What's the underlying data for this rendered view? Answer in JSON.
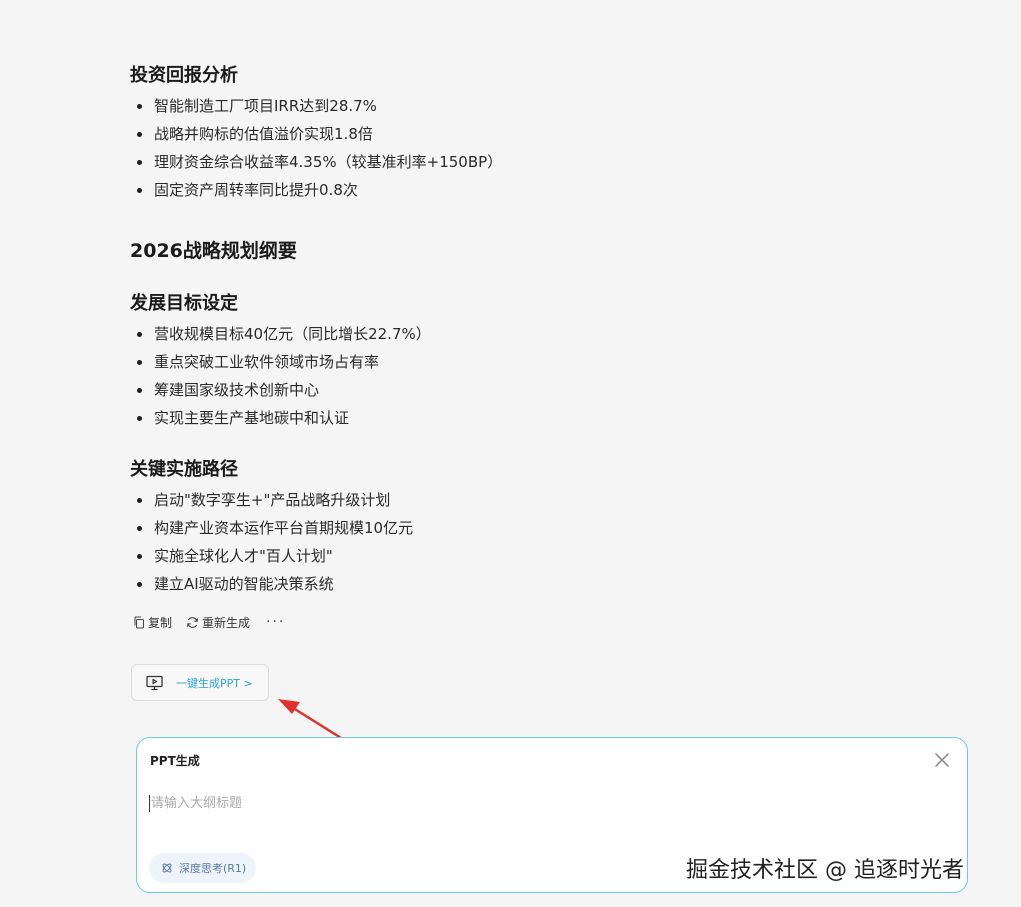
{
  "sections": {
    "investment": {
      "heading": "投资回报分析",
      "items": [
        "智能制造工厂项目IRR达到28.7%",
        "战略并购标的估值溢价实现1.8倍",
        "理财资金综合收益率4.35%（较基准利率+150BP）",
        "固定资产周转率同比提升0.8次"
      ]
    },
    "strategy_title": "2026战略规划纲要",
    "goals": {
      "heading": "发展目标设定",
      "items": [
        "营收规模目标40亿元（同比增长22.7%）",
        "重点突破工业软件领域市场占有率",
        "筹建国家级技术创新中心",
        "实现主要生产基地碳中和认证"
      ]
    },
    "paths": {
      "heading": "关键实施路径",
      "items": [
        "启动\"数字孪生+\"产品战略升级计划",
        "构建产业资本运作平台首期规模10亿元",
        "实施全球化人才\"百人计划\"",
        "建立AI驱动的智能决策系统"
      ]
    }
  },
  "actions": {
    "copy_label": "复制",
    "regenerate_label": "重新生成",
    "more_label": "···"
  },
  "ppt_button": {
    "label": "一键生成PPT >"
  },
  "ppt_panel": {
    "title": "PPT生成",
    "input_placeholder": "请输入大纲标题",
    "input_value": "",
    "deep_think_label": "深度思考(R1)"
  },
  "watermark": "掘金技术社区 @ 追逐时光者",
  "colors": {
    "accent": "#2aa3d8",
    "panel_border": "#6cc9ea",
    "arrow": "#e0322b"
  },
  "icons": {
    "copy": "copy-icon",
    "regenerate": "refresh-icon",
    "ppt": "presentation-icon",
    "close": "close-icon",
    "deep_think": "atom-icon"
  }
}
